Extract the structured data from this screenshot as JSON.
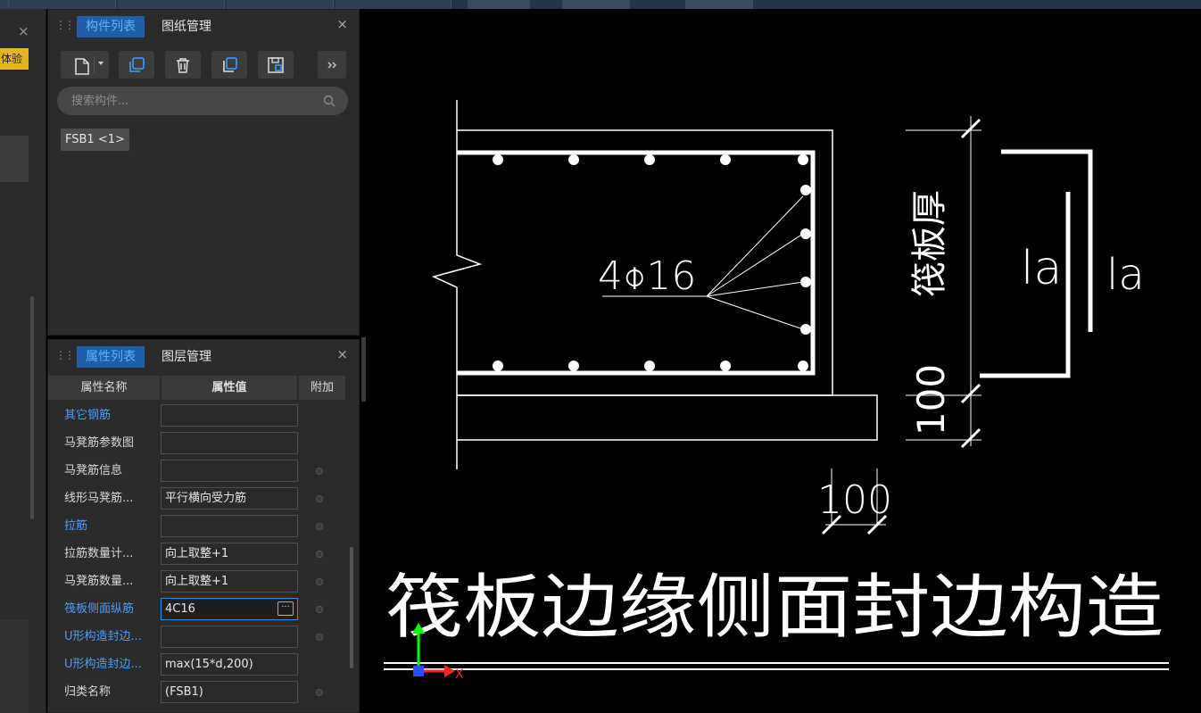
{
  "left_strip": {
    "close_glyph": "×",
    "badge_text": "体验"
  },
  "component_panel": {
    "tabs": [
      "构件列表",
      "图纸管理"
    ],
    "active_tab": 0,
    "close_glyph": "×",
    "toolbar": [
      "new-component",
      "copy",
      "delete",
      "duplicate",
      "save-template",
      "more"
    ],
    "search": {
      "placeholder": "搜索构件...",
      "value": ""
    },
    "components": [
      {
        "label": "FSB1 <1>"
      }
    ]
  },
  "property_panel": {
    "tabs": [
      "属性列表",
      "图层管理"
    ],
    "active_tab": 0,
    "close_glyph": "×",
    "columns": [
      "属性名称",
      "属性值",
      "附加"
    ],
    "rows": [
      {
        "name": "其它钢筋",
        "value": "",
        "link": true,
        "dot": false
      },
      {
        "name": "马凳筋参数图",
        "value": "",
        "link": false,
        "dot": false
      },
      {
        "name": "马凳筋信息",
        "value": "",
        "link": false,
        "dot": true
      },
      {
        "name": "线形马凳筋...",
        "value": "平行横向受力筋",
        "link": false,
        "dot": true
      },
      {
        "name": "拉筋",
        "value": "",
        "link": true,
        "dot": true
      },
      {
        "name": "拉筋数量计...",
        "value": "向上取整+1",
        "link": false,
        "dot": true
      },
      {
        "name": "马凳筋数量...",
        "value": "向上取整+1",
        "link": false,
        "dot": true
      },
      {
        "name": "筏板侧面纵筋",
        "value": "4C16",
        "link": true,
        "dot": true,
        "focused": true
      },
      {
        "name": "U形构造封边...",
        "value": "",
        "link": true,
        "dot": true
      },
      {
        "name": "U形构造封边...",
        "value": "max(15*d,200)",
        "link": true,
        "dot": false
      },
      {
        "name": "归类名称",
        "value": "(FSB1)",
        "link": false,
        "dot": true
      }
    ]
  },
  "drawing": {
    "rebar_label": "4⌽16",
    "thickness_label": "筏板厚",
    "la_label": "la",
    "dim_100": "100",
    "title": "筏板边缘侧面封边构造",
    "axis_x": "X",
    "colors": {
      "line": "#ffffff",
      "axis_y": "#00ff00",
      "axis_x": "#ff2020",
      "origin": "#2a4dff"
    }
  }
}
